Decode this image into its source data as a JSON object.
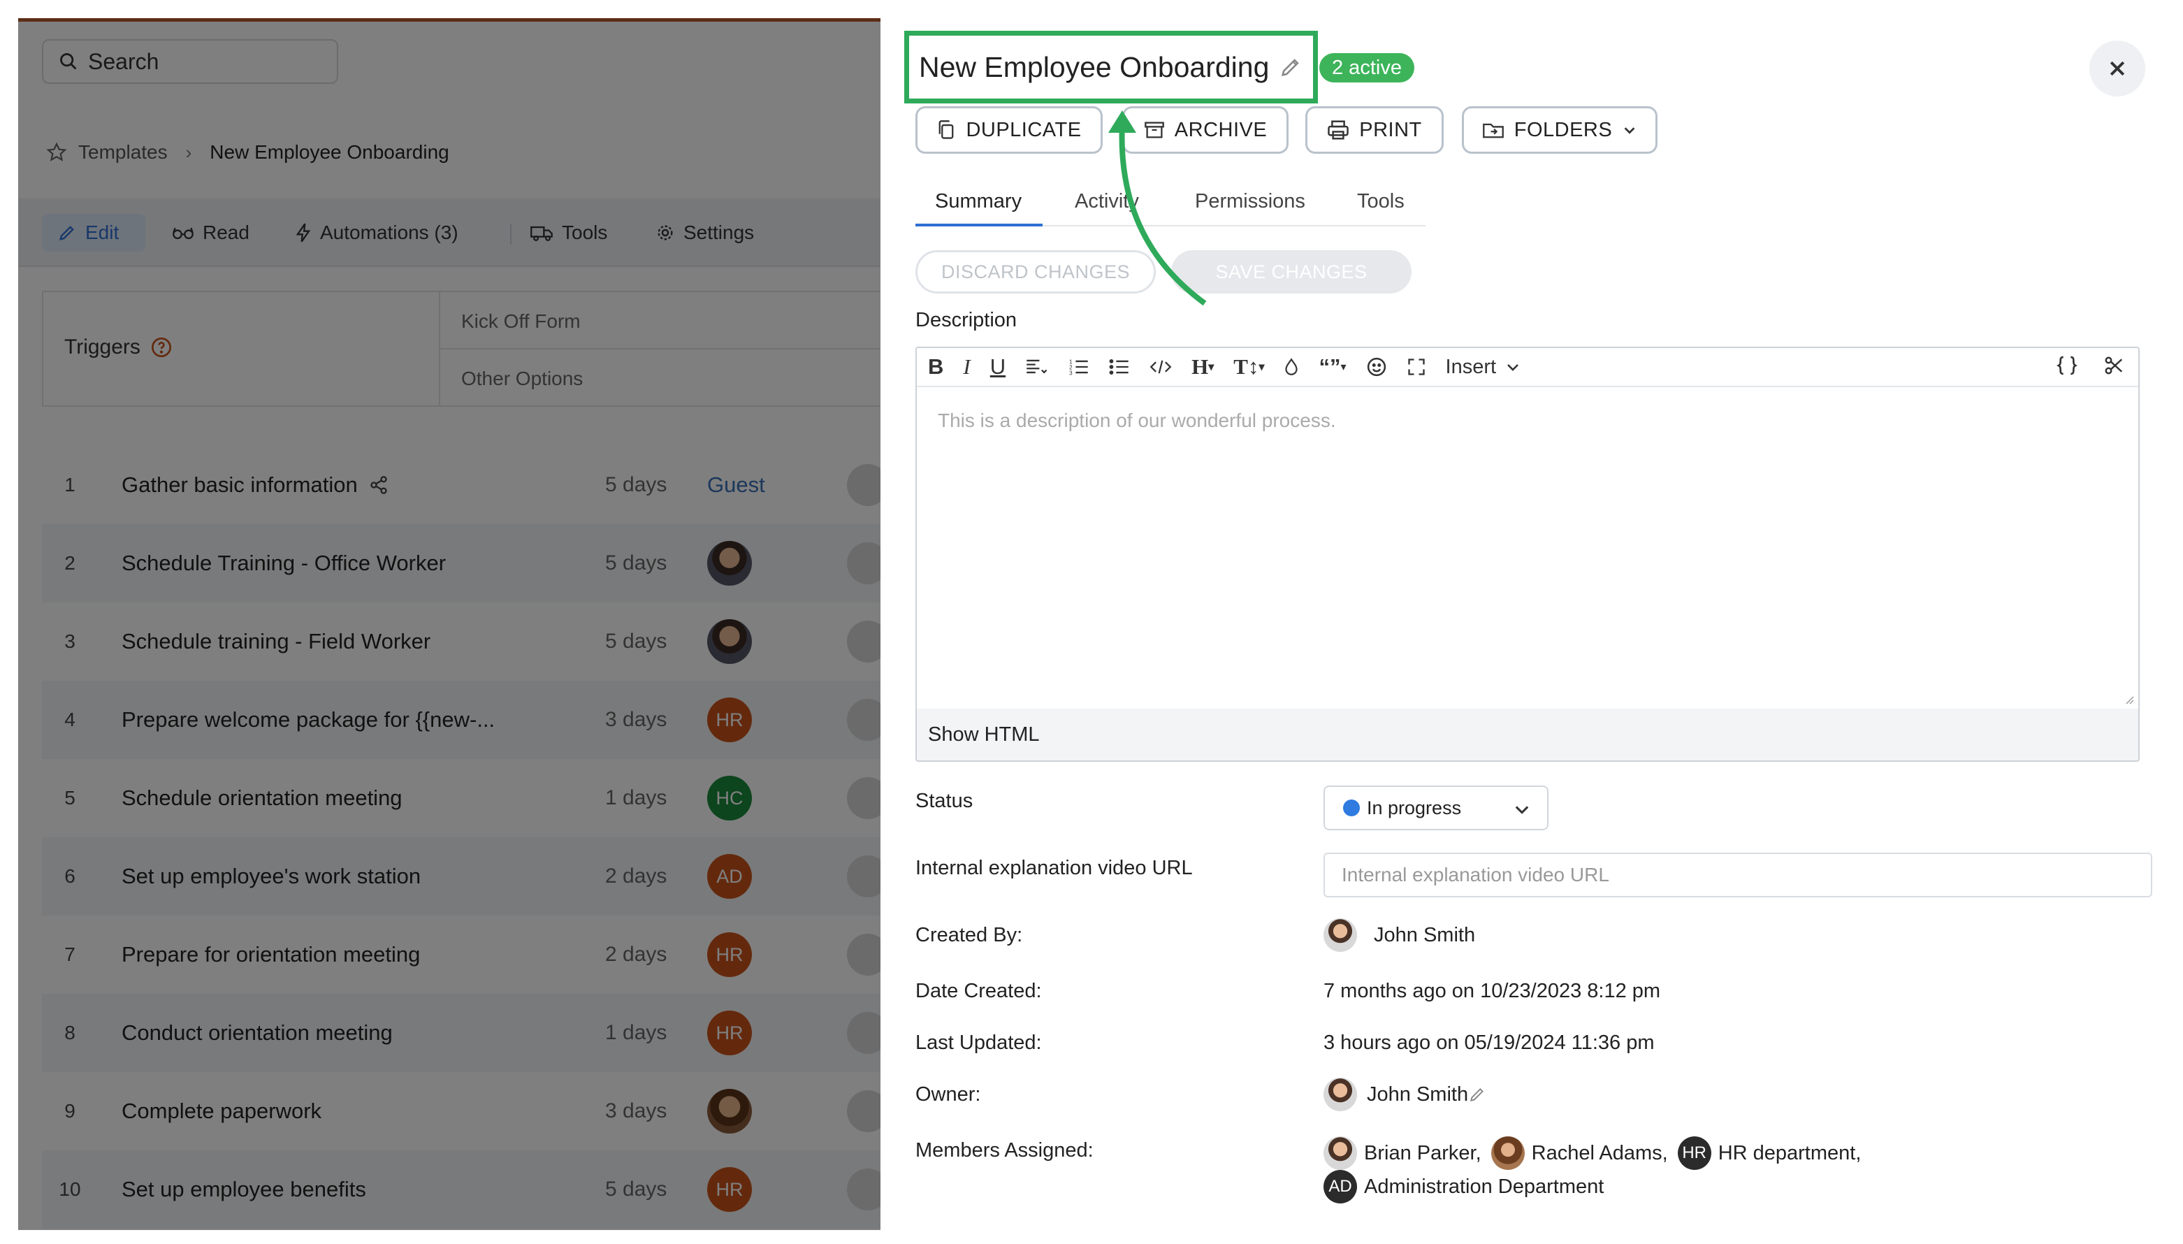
{
  "left": {
    "search_label": "Search",
    "breadcrumb": {
      "root": "Templates",
      "current": "New Employee Onboarding"
    },
    "tabs": [
      {
        "label": "Edit"
      },
      {
        "label": "Read"
      },
      {
        "label": "Automations (3)"
      },
      {
        "label": "Tools"
      },
      {
        "label": "Settings"
      }
    ],
    "triggers": {
      "label": "Triggers",
      "options": [
        "Kick Off Form",
        "Other Options"
      ]
    },
    "tasks": [
      {
        "num": "1",
        "name": "Gather basic information",
        "duration": "5 days",
        "assignee": "Guest",
        "assignee_type": "text"
      },
      {
        "num": "2",
        "name": "Schedule Training - Office Worker",
        "duration": "5 days",
        "assignee": "",
        "assignee_type": "photo"
      },
      {
        "num": "3",
        "name": "Schedule training - Field Worker",
        "duration": "5 days",
        "assignee": "",
        "assignee_type": "photo"
      },
      {
        "num": "4",
        "name": "Prepare welcome package for {{new-...",
        "duration": "3 days",
        "assignee": "HR",
        "assignee_type": "hr"
      },
      {
        "num": "5",
        "name": "Schedule orientation meeting",
        "duration": "1 days",
        "assignee": "HC",
        "assignee_type": "hc"
      },
      {
        "num": "6",
        "name": "Set up employee's work station",
        "duration": "2 days",
        "assignee": "AD",
        "assignee_type": "ad"
      },
      {
        "num": "7",
        "name": "Prepare for orientation meeting",
        "duration": "2 days",
        "assignee": "HR",
        "assignee_type": "hr"
      },
      {
        "num": "8",
        "name": "Conduct orientation meeting",
        "duration": "1 days",
        "assignee": "HR",
        "assignee_type": "hr"
      },
      {
        "num": "9",
        "name": "Complete paperwork",
        "duration": "3 days",
        "assignee": "",
        "assignee_type": "photo2"
      },
      {
        "num": "10",
        "name": "Set up employee benefits",
        "duration": "5 days",
        "assignee": "HR",
        "assignee_type": "hr"
      }
    ]
  },
  "panel": {
    "title": "New Employee Onboarding",
    "active_badge": "2 active",
    "buttons": {
      "duplicate": "DUPLICATE",
      "archive": "ARCHIVE",
      "print": "PRINT",
      "folders": "FOLDERS"
    },
    "subtabs": {
      "summary": "Summary",
      "activity": "Activity",
      "permissions": "Permissions",
      "tools": "Tools"
    },
    "discard_label": "DISCARD CHANGES",
    "save_label": "SAVE CHANGES",
    "description_label": "Description",
    "editor": {
      "insert_label": "Insert",
      "placeholder": "This is a description of our wonderful process.",
      "show_html": "Show HTML"
    },
    "fields": {
      "status_label": "Status",
      "status_value": "In progress",
      "video_label": "Internal explanation video URL",
      "video_placeholder": "Internal explanation video URL",
      "created_by_label": "Created By:",
      "created_by": "John Smith",
      "date_created_label": "Date Created:",
      "date_created": "7 months ago on 10/23/2023 8:12 pm",
      "last_updated_label": "Last Updated:",
      "last_updated": "3 hours ago on 05/19/2024 11:36 pm",
      "owner_label": "Owner:",
      "owner": "John Smith",
      "members_label": "Members Assigned:",
      "members": [
        {
          "name": "Brian Parker,",
          "initials": ""
        },
        {
          "name": "Rachel Adams,",
          "initials": ""
        },
        {
          "name": "HR department,",
          "initials": "HR"
        },
        {
          "name": "Administration Department",
          "initials": "AD"
        }
      ]
    }
  },
  "colors": {
    "highlight_green": "#2eaa5a",
    "badge_green": "#3db45a",
    "accent_blue": "#2f6fd3",
    "status_dot": "#2f7be0",
    "hr_orange": "#c9531a",
    "hc_green": "#1b8a3d"
  }
}
